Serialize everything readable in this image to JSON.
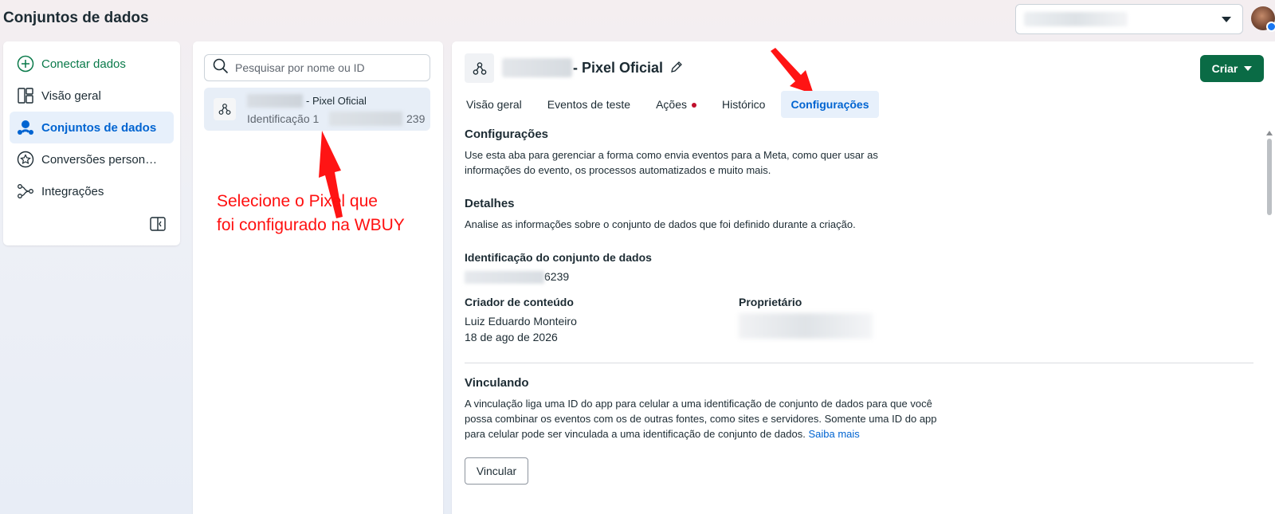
{
  "header": {
    "title": "Conjuntos de dados"
  },
  "nav": {
    "items": [
      {
        "label": "Conectar dados",
        "icon": "plus-circle-icon"
      },
      {
        "label": "Visão geral",
        "icon": "layout-icon"
      },
      {
        "label": "Conjuntos de dados",
        "icon": "people-icon"
      },
      {
        "label": "Conversões person…",
        "icon": "star-badge-icon"
      },
      {
        "label": "Integrações",
        "icon": "integration-icon"
      }
    ]
  },
  "list": {
    "search_placeholder": "Pesquisar por nome ou ID",
    "dataset": {
      "name": "- Pixel Oficial",
      "id_prefix": "Identificação 1",
      "id_suffix": "239"
    },
    "annotation": [
      "Selecione o Pixel que",
      "foi configurado na WBUY"
    ]
  },
  "detail": {
    "title": "- Pixel Oficial",
    "create_label": "Criar",
    "tabs": [
      "Visão geral",
      "Eventos de teste",
      "Ações",
      "Histórico",
      "Configurações"
    ],
    "settings": {
      "title": "Configurações",
      "text": "Use esta aba para gerenciar a forma como envia eventos para a Meta, como quer usar as informações do evento, os processos automatizados e muito mais."
    },
    "details": {
      "title": "Detalhes",
      "text": "Analise as informações sobre o conjunto de dados que foi definido durante a criação.",
      "id_label": "Identificação do conjunto de dados",
      "id_suffix": "6239",
      "creator_label": "Criador de conteúdo",
      "creator_name": "Luiz Eduardo Monteiro",
      "creator_date": "18 de ago de 2026",
      "owner_label": "Proprietário"
    },
    "linking": {
      "title": "Vinculando",
      "text": "A vinculação liga uma ID do app para celular a uma identificação de conjunto de dados para que você possa combinar os eventos com os de outras fontes, como sites e servidores. Somente uma ID do app para celular pode ser vinculada a uma identificação de conjunto de dados.",
      "link_label": "Saiba mais",
      "button_label": "Vincular"
    }
  },
  "colors": {
    "accent": "#0064d1",
    "create_button": "#0a6b45",
    "annotation": "#ff1010"
  }
}
